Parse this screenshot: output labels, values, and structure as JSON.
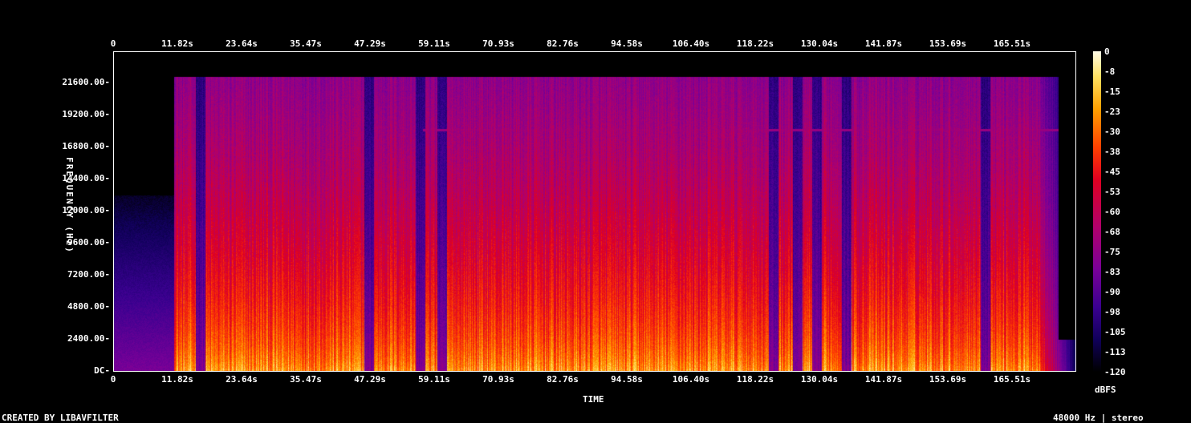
{
  "chart_data": {
    "type": "heatmap",
    "x_ticks": [
      "0",
      "11.82s",
      "23.64s",
      "35.47s",
      "47.29s",
      "59.11s",
      "70.93s",
      "82.76s",
      "94.58s",
      "106.40s",
      "118.22s",
      "130.04s",
      "141.87s",
      "153.69s",
      "165.51s"
    ],
    "y_ticks": [
      "DC",
      "2400.00",
      "4800.00",
      "7200.00",
      "9600.00",
      "12000.00",
      "14400.00",
      "16800.00",
      "19200.00",
      "21600.00"
    ],
    "xlabel": "TIME",
    "ylabel": "FREQUENCY (Hz)",
    "colorbar_ticks": [
      "0",
      "-8",
      "-15",
      "-23",
      "-30",
      "-38",
      "-45",
      "-53",
      "-60",
      "-68",
      "-75",
      "-83",
      "-90",
      "-98",
      "-105",
      "-113",
      "-120"
    ],
    "colorbar_label": "dBFS",
    "duration_s": 177.3,
    "ylim": [
      0,
      24000
    ],
    "clim": [
      -120,
      0
    ],
    "bright_segments": [
      [
        11.2,
        182.0
      ]
    ],
    "quiet_start_end_s": [
      0,
      11.2
    ]
  },
  "footer": {
    "left": "CREATED BY LIBAVFILTER",
    "right": "48000 Hz | stereo"
  }
}
